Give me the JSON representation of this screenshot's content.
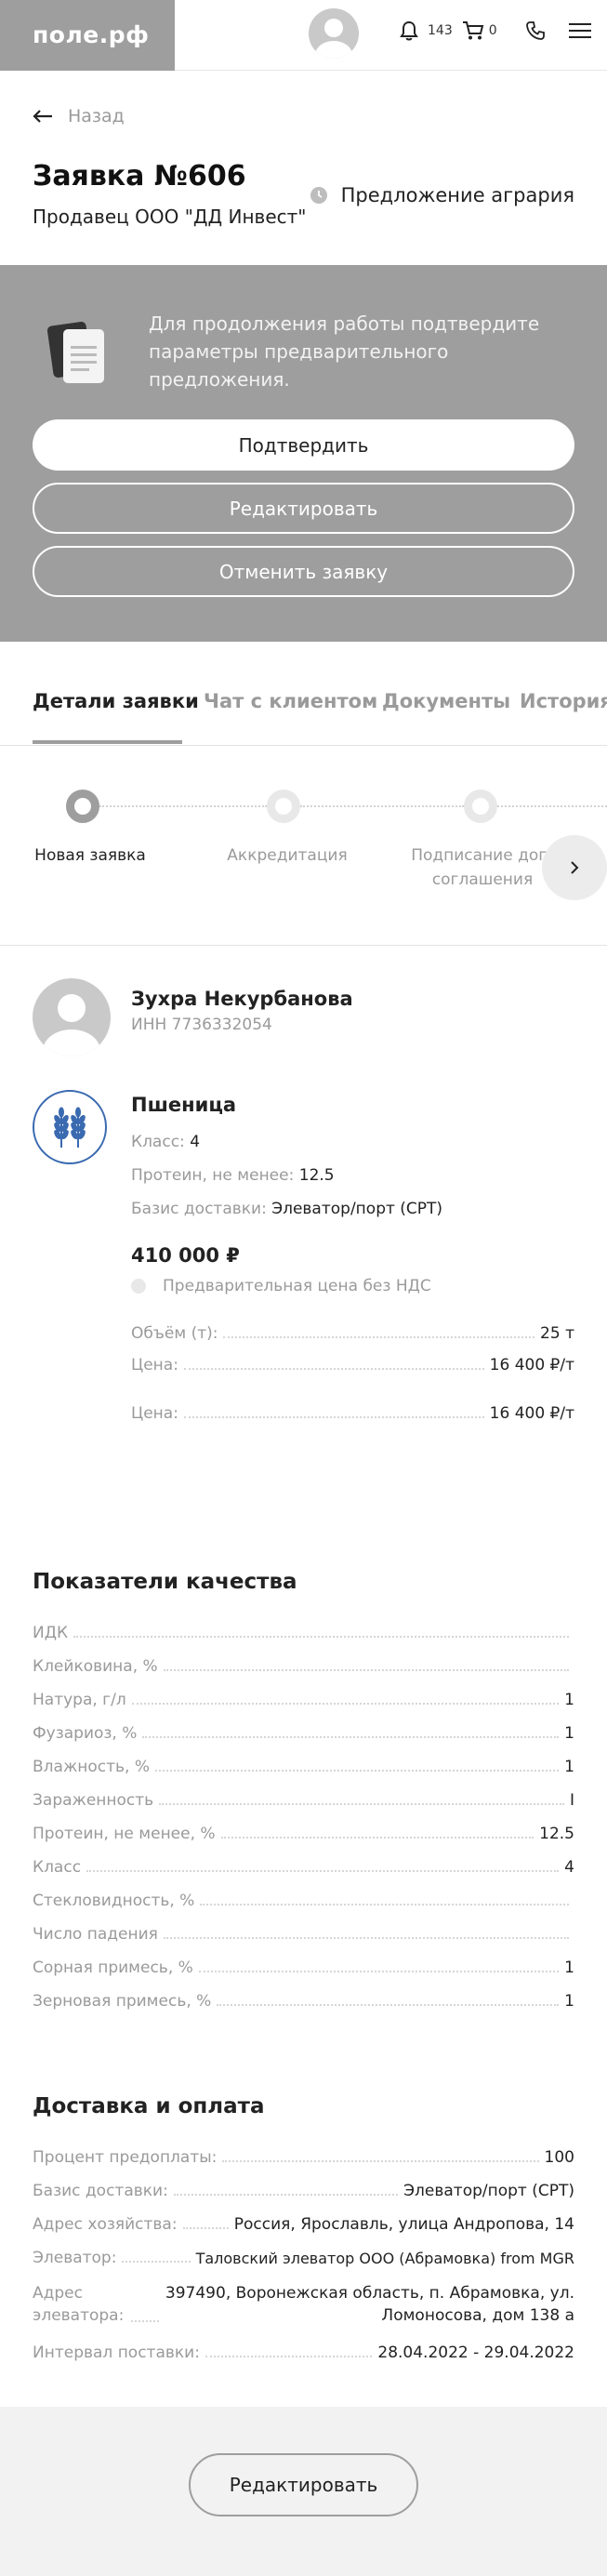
{
  "header": {
    "logo": "поле.рф",
    "notifications_count": "143",
    "cart_count": "0"
  },
  "nav": {
    "back_label": "Назад"
  },
  "order": {
    "title": "Заявка №606",
    "seller": "Продавец ООО \"ДД Инвест\"",
    "proposal_status": "Предложение агрария"
  },
  "confirm_panel": {
    "message": "Для продолжения работы подтвердите параметры предварительного предложения.",
    "confirm_label": "Подтвердить",
    "edit_label": "Редактировать",
    "cancel_label": "Отменить заявку"
  },
  "tabs": [
    {
      "label": "Детали заявки"
    },
    {
      "label": "Чат с клиентом"
    },
    {
      "label": "Документы"
    },
    {
      "label": "История"
    }
  ],
  "steps": [
    {
      "label": "Новая заявка"
    },
    {
      "label": "Аккредитация"
    },
    {
      "label": "Подписание доп. соглашения"
    }
  ],
  "customer": {
    "name": "Зухра Некурбанова",
    "inn": "ИНН 7736332054"
  },
  "product": {
    "name": "Пшеница",
    "class_label": "Класс:",
    "class_value": "4",
    "protein_label": "Протеин, не менее:",
    "protein_value": "12.5",
    "basis_label": "Базис доставки:",
    "basis_value": "Элеватор/порт (CPT)",
    "price": "410 000 ₽",
    "price_note": "Предварительная цена без НДС",
    "rows": [
      {
        "label": "Объём (т):",
        "value": "25 т"
      },
      {
        "label": "Цена:",
        "value": "16 400 ₽/т"
      },
      {
        "label": "Цена:",
        "value": "16 400 ₽/т"
      }
    ]
  },
  "quality": {
    "title": "Показатели качества",
    "rows": [
      {
        "label": "ИДК",
        "value": ""
      },
      {
        "label": "Клейковина, %",
        "value": ""
      },
      {
        "label": "Натура, г/л",
        "value": "1"
      },
      {
        "label": "Фузариоз, %",
        "value": "1"
      },
      {
        "label": "Влажность, %",
        "value": "1"
      },
      {
        "label": "Зараженность",
        "value": "I"
      },
      {
        "label": "Протеин, не менее, %",
        "value": "12.5"
      },
      {
        "label": "Класс",
        "value": "4"
      },
      {
        "label": "Стекловидность, %",
        "value": ""
      },
      {
        "label": "Число падения",
        "value": ""
      },
      {
        "label": "Сорная примесь, %",
        "value": "1"
      },
      {
        "label": "Зерновая примесь, %",
        "value": "1"
      }
    ]
  },
  "delivery": {
    "title": "Доставка и оплата",
    "rows": [
      {
        "label": "Процент предоплаты:",
        "value": "100"
      },
      {
        "label": "Базис доставки:",
        "value": "Элеватор/порт (CPT)"
      },
      {
        "label": "Адрес хозяйства:",
        "value": "Россия, Ярославль, улица Андропова, 14"
      },
      {
        "label": "Элеватор:",
        "value": "Таловский элеватор ООО (Абрамовка) from MGR"
      },
      {
        "label": "Адрес элеватора:",
        "value": "397490, Воронежская область, п. Абрамовка, ул. Ломоносова, дом 138 а"
      },
      {
        "label": "Интервал поставки:",
        "value": "28.04.2022 - 29.04.2022"
      }
    ]
  },
  "footer": {
    "edit_label": "Редактировать"
  },
  "colors": {
    "panel_gray": "#9e9e9e",
    "accent_blue": "#3a6ab0"
  }
}
